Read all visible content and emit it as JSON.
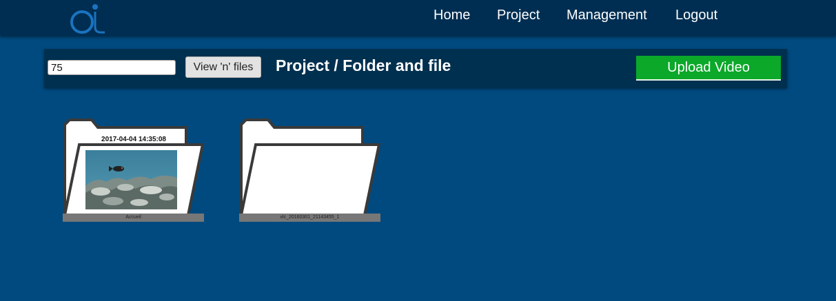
{
  "nav": {
    "logo_icon": "ai-logo-icon",
    "links": [
      "Home",
      "Project",
      "Management",
      "Logout"
    ]
  },
  "toolbar": {
    "count_value": "75",
    "view_button": "View 'n' files",
    "title": "Project / Folder and file",
    "upload_button": "Upload Video"
  },
  "folders": [
    {
      "date": "2017-04-04 14:35:08",
      "label": "Accueil",
      "has_thumbnail": true
    },
    {
      "date": "",
      "label": "vlc_20160301_21143455_1",
      "has_thumbnail": false
    }
  ],
  "colors": {
    "background": "#004a7f",
    "navbar": "#002e52",
    "toolbar": "#00304f",
    "upload_button": "#0ba82a",
    "logo": "#1a73c0"
  }
}
